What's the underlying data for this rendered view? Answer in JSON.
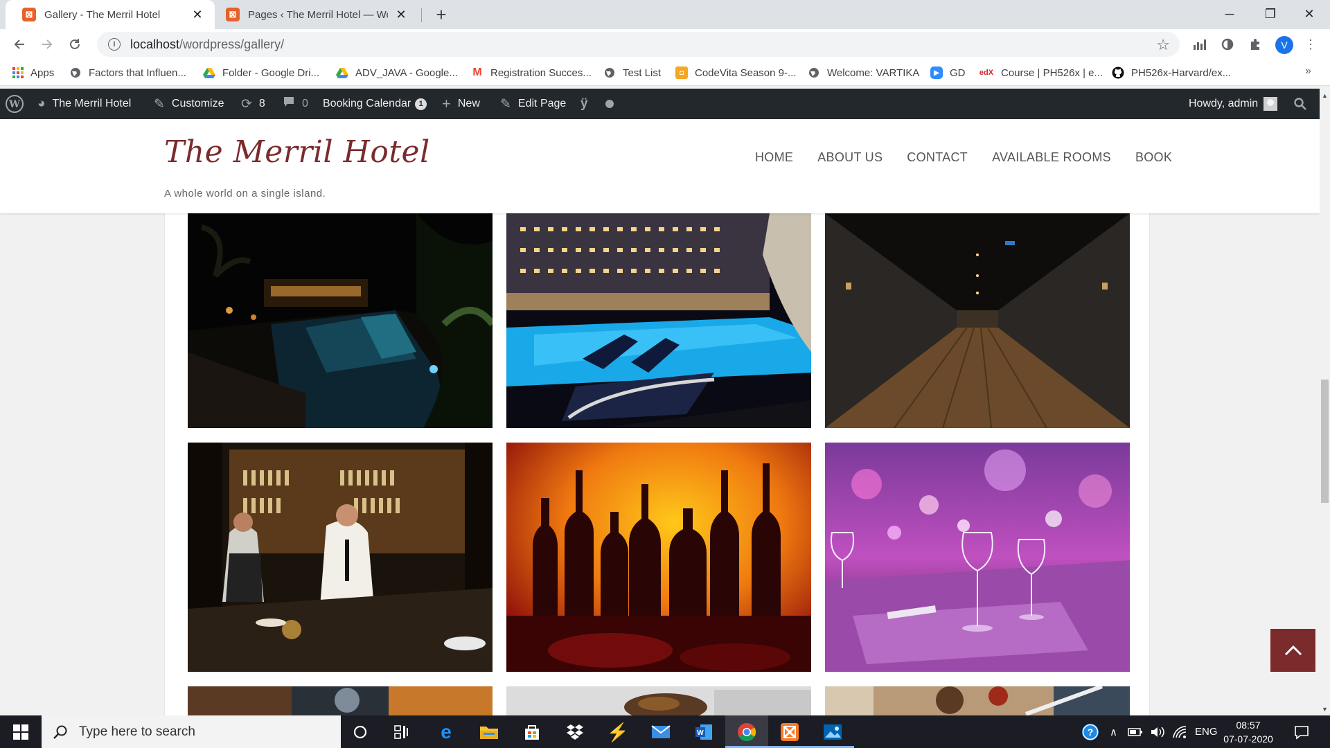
{
  "browser": {
    "tabs": [
      {
        "title": "Gallery - The Merril Hotel",
        "favicon": "xampp-icon",
        "active": true
      },
      {
        "title": "Pages ‹ The Merril Hotel — Word",
        "favicon": "xampp-icon",
        "active": false
      }
    ],
    "url_host": "localhost",
    "url_path": "/wordpress/gallery/",
    "profile_initial": "V",
    "bookmarks": [
      {
        "label": "Apps",
        "icon": "apps-grid-icon"
      },
      {
        "label": "Factors that Influen...",
        "icon": "globe-icon"
      },
      {
        "label": "Folder - Google Dri...",
        "icon": "google-drive-icon"
      },
      {
        "label": "ADV_JAVA - Google...",
        "icon": "google-drive-icon"
      },
      {
        "label": "Registration Succes...",
        "icon": "gmail-icon"
      },
      {
        "label": "Test List",
        "icon": "globe-icon"
      },
      {
        "label": "CodeVita Season 9-...",
        "icon": "codevita-icon"
      },
      {
        "label": "Welcome: VARTIKA",
        "icon": "globe-icon"
      },
      {
        "label": "GD",
        "icon": "zoom-icon"
      },
      {
        "label": "Course | PH526x | e...",
        "icon": "edx-icon"
      },
      {
        "label": "PH526x-Harvard/ex...",
        "icon": "github-icon"
      }
    ]
  },
  "adminbar": {
    "site_name": "The Merril Hotel",
    "customize": "Customize",
    "updates_count": "8",
    "comments_count": "0",
    "booking_calendar": "Booking Calendar",
    "booking_badge": "1",
    "new": "New",
    "edit_page": "Edit Page",
    "howdy": "Howdy, admin"
  },
  "site": {
    "title": "The Merril Hotel",
    "tagline": "A whole world on a single island.",
    "nav": [
      "HOME",
      "ABOUT US",
      "CONTACT",
      "AVAILABLE ROOMS",
      "BOOK"
    ]
  },
  "gallery": {
    "photos": [
      "night-pool-palms-photo",
      "hotel-pool-night-photo",
      "hotel-corridor-photo",
      "hotel-bar-bartenders-photo",
      "bottles-silhouette-photo",
      "wine-glasses-table-photo",
      "cocktail-glass-photo",
      "food-plate-photo",
      "dining-table-photo"
    ]
  },
  "taskbar": {
    "search_placeholder": "Type here to search",
    "language": "ENG",
    "time": "08:57",
    "date": "07-07-2020"
  },
  "colors": {
    "brand": "#7b2b2c",
    "adminbar": "#23282d",
    "taskbar": "#1c1c24"
  }
}
